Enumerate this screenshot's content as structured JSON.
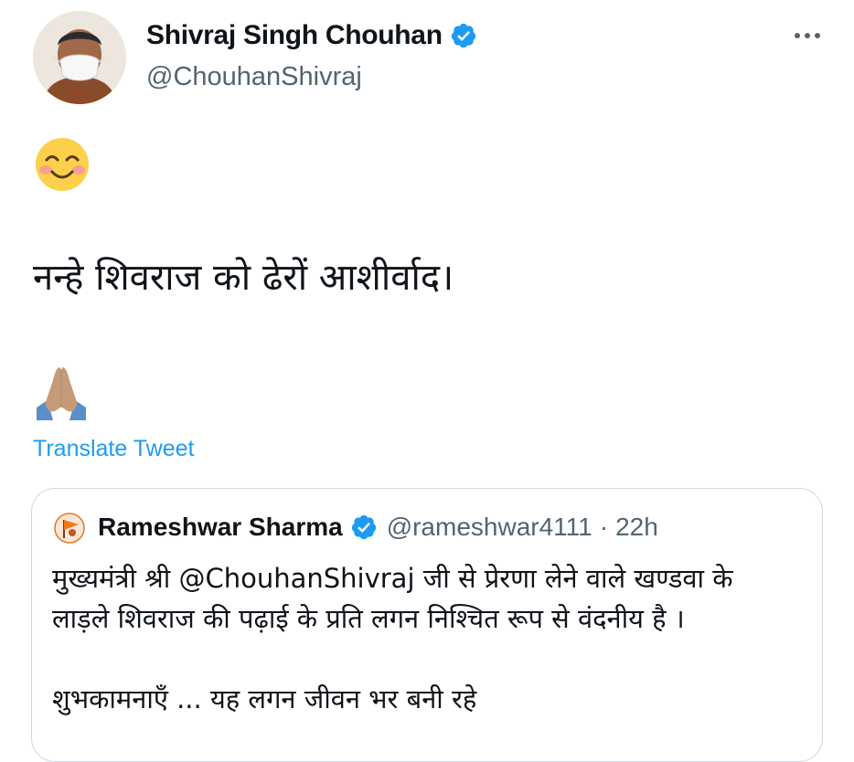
{
  "tweet": {
    "author": {
      "display_name": "Shivraj Singh Chouhan",
      "handle": "@ChouhanShivraj",
      "verified": true,
      "avatar_icon": "profile-photo-man-with-white-mask"
    },
    "more_icon": "more-horizontal-icon",
    "emoji_top": "smiling-face-with-smiling-eyes",
    "text": "नन्हे शिवराज को ढेरों आशीर्वाद।",
    "emoji_bottom": "folded-hands",
    "translate_label": "Translate Tweet"
  },
  "quoted_tweet": {
    "author": {
      "display_name": "Rameshwar Sharma",
      "handle": "@rameshwar4111",
      "verified": true,
      "avatar_icon": "saffron-flag-avatar"
    },
    "separator": "·",
    "time": "22h",
    "text_lines": [
      "मुख्यमंत्री श्री @ChouhanShivraj जी से प्रेरणा लेने वाले खण्डवा के",
      "लाड़ले शिवराज की पढ़ाई के प्रति लगन निश्चित रूप से वंदनीय है ।"
    ],
    "text_line_after_break": "शुभकामनाएँ ... यह लगन जीवन भर बनी रहे"
  },
  "colors": {
    "accent": "#1d9bf0",
    "text_primary": "#0f1419",
    "text_secondary": "#536471",
    "border": "#cfd9de"
  }
}
